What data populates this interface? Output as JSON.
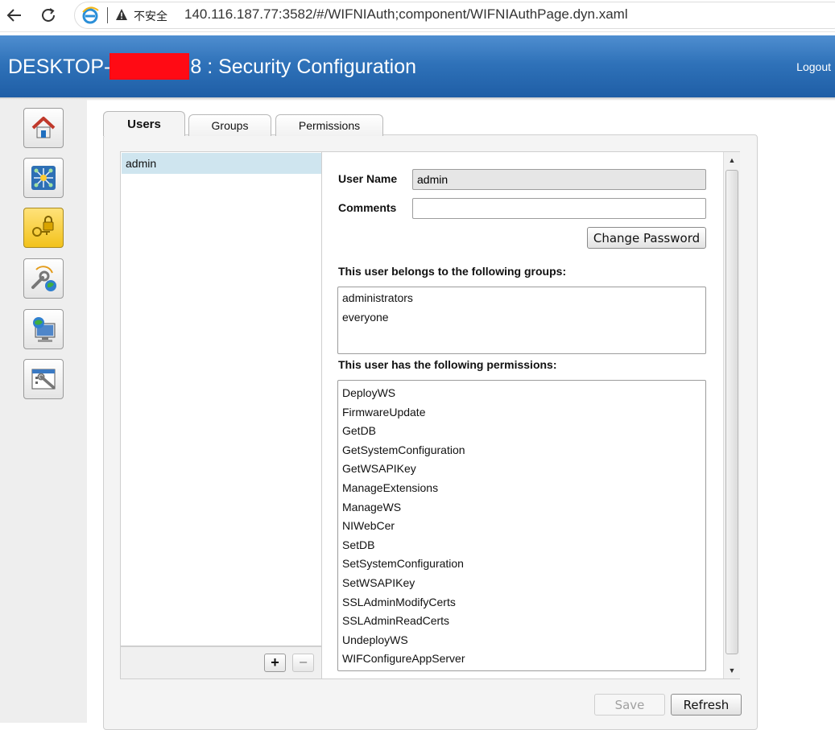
{
  "browser": {
    "insecure_label": "不安全",
    "url": "140.116.187.77:3582/#/WIFNIAuth;component/WIFNIAuthPage.dyn.xaml"
  },
  "header": {
    "title_prefix": "DESKTOP-",
    "title_suffix": "8 : Security Configuration",
    "logout": "Logout"
  },
  "sidebar": {
    "icons": [
      "home-icon",
      "network-icon",
      "security-lock-icon",
      "tools-globe-icon",
      "web-computer-icon",
      "settings-window-icon"
    ],
    "active_index": 2
  },
  "tabs": [
    {
      "label": "Users",
      "active": true
    },
    {
      "label": "Groups",
      "active": false
    },
    {
      "label": "Permissions",
      "active": false
    }
  ],
  "users": {
    "items": [
      "admin"
    ],
    "selected": "admin",
    "add_label": "+",
    "remove_label": "−"
  },
  "detail": {
    "user_name_label": "User Name",
    "user_name_value": "admin",
    "comments_label": "Comments",
    "comments_value": "",
    "change_password_label": "Change Password",
    "groups_label": "This user belongs to the following groups:",
    "groups": [
      "administrators",
      "everyone"
    ],
    "permissions_label": "This user has the following permissions:",
    "permissions": [
      "DeployWS",
      "FirmwareUpdate",
      "GetDB",
      "GetSystemConfiguration",
      "GetWSAPIKey",
      "ManageExtensions",
      "ManageWS",
      "NIWebCer",
      "SetDB",
      "SetSystemConfiguration",
      "SetWSAPIKey",
      "SSLAdminModifyCerts",
      "SSLAdminReadCerts",
      "UndeployWS",
      "WIFConfigureAppServer"
    ]
  },
  "actions": {
    "save_label": "Save",
    "refresh_label": "Refresh"
  },
  "colors": {
    "header_blue": "#2f72b9",
    "selection": "#cfe5ef",
    "redaction": "#ff0a14"
  }
}
